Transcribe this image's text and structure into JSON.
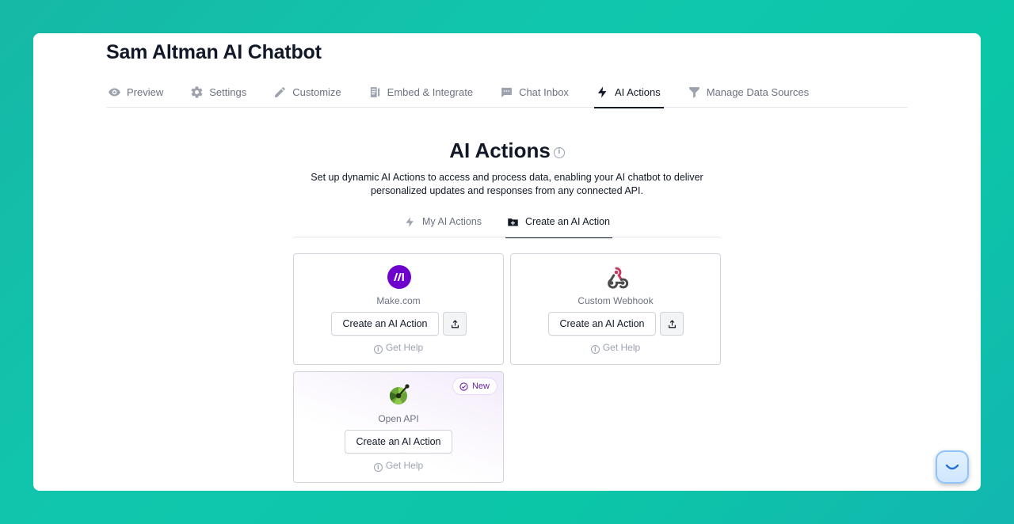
{
  "page": {
    "title": "Sam Altman AI Chatbot"
  },
  "main_tabs": [
    {
      "label": "Preview",
      "icon": "eye-icon"
    },
    {
      "label": "Settings",
      "icon": "gear-icon"
    },
    {
      "label": "Customize",
      "icon": "pencil-icon"
    },
    {
      "label": "Embed & Integrate",
      "icon": "embed-icon"
    },
    {
      "label": "Chat Inbox",
      "icon": "chat-icon"
    },
    {
      "label": "AI Actions",
      "icon": "bolt-icon",
      "active": true
    },
    {
      "label": "Manage Data Sources",
      "icon": "funnel-icon"
    }
  ],
  "section": {
    "title": "AI Actions",
    "description_line1": "Set up dynamic AI Actions to access and process data, enabling your AI chatbot to deliver",
    "description_line2": "personalized updates and responses from any connected API."
  },
  "sub_tabs": [
    {
      "label": "My AI Actions",
      "icon": "bolt-icon"
    },
    {
      "label": "Create an AI Action",
      "icon": "folder-plus-icon",
      "active": true
    }
  ],
  "cards": [
    {
      "name": "Make.com",
      "button": "Create an AI Action",
      "help": "Get Help",
      "icon": "make-logo"
    },
    {
      "name": "Custom Webhook",
      "button": "Create an AI Action",
      "help": "Get Help",
      "icon": "webhook-logo"
    },
    {
      "name": "Open API",
      "button": "Create an AI Action",
      "help": "Get Help",
      "icon": "openapi-logo",
      "badge": "New"
    }
  ],
  "colors": {
    "background": "#10c7ad",
    "text": "#111827",
    "muted": "#6b7280",
    "make_purple": "#6d00cc",
    "badge_purple": "#6b21a8"
  }
}
